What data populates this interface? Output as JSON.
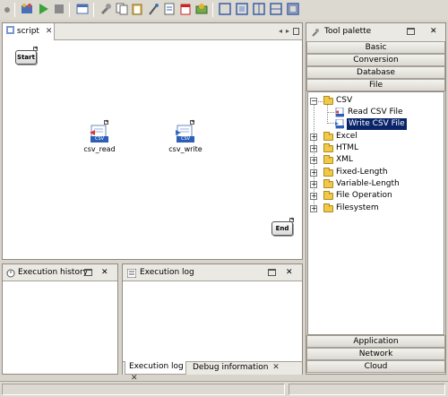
{
  "toolbar": {
    "icons": [
      "gear-icon",
      "run-icon",
      "stop-icon",
      "window-icon",
      "wrench-icon",
      "copy-icon",
      "paste-icon",
      "wand-icon",
      "document-icon",
      "calendar-icon",
      "component-icon",
      "frame-icon",
      "frame-icon",
      "frame-icon",
      "frame-icon",
      "frame-icon"
    ]
  },
  "script": {
    "tab_label": "script",
    "close": "✕",
    "start_label": "Start",
    "end_label": "End",
    "components": [
      {
        "name": "csv_read",
        "badge": "CSV"
      },
      {
        "name": "csv_write",
        "badge": "CSV"
      }
    ]
  },
  "execution_history": {
    "title": "Execution history",
    "close": "✕"
  },
  "execution_log": {
    "title": "Execution log",
    "close": "✕",
    "bottom_tabs": [
      {
        "label": "Execution log",
        "close": "✕"
      },
      {
        "label": "Debug information",
        "close": "✕"
      }
    ]
  },
  "palette": {
    "title": "Tool palette",
    "close": "✕",
    "top_categories": [
      "Basic",
      "Conversion",
      "Database",
      "File"
    ],
    "tree": [
      {
        "label": "CSV",
        "expanded": true,
        "children": [
          "Read CSV File",
          "Write CSV File"
        ],
        "selected": "Write CSV File"
      },
      {
        "label": "Excel"
      },
      {
        "label": "HTML"
      },
      {
        "label": "XML"
      },
      {
        "label": "Fixed-Length"
      },
      {
        "label": "Variable-Length"
      },
      {
        "label": "File Operation"
      },
      {
        "label": "Filesystem"
      }
    ],
    "expand_minus": "−",
    "expand_plus": "+",
    "bottom_categories": [
      "Application",
      "Network",
      "Cloud"
    ]
  },
  "colors": {
    "selection": "#0a246a",
    "csv_badge": "#2c5fb5",
    "run": "#3aa33a"
  }
}
